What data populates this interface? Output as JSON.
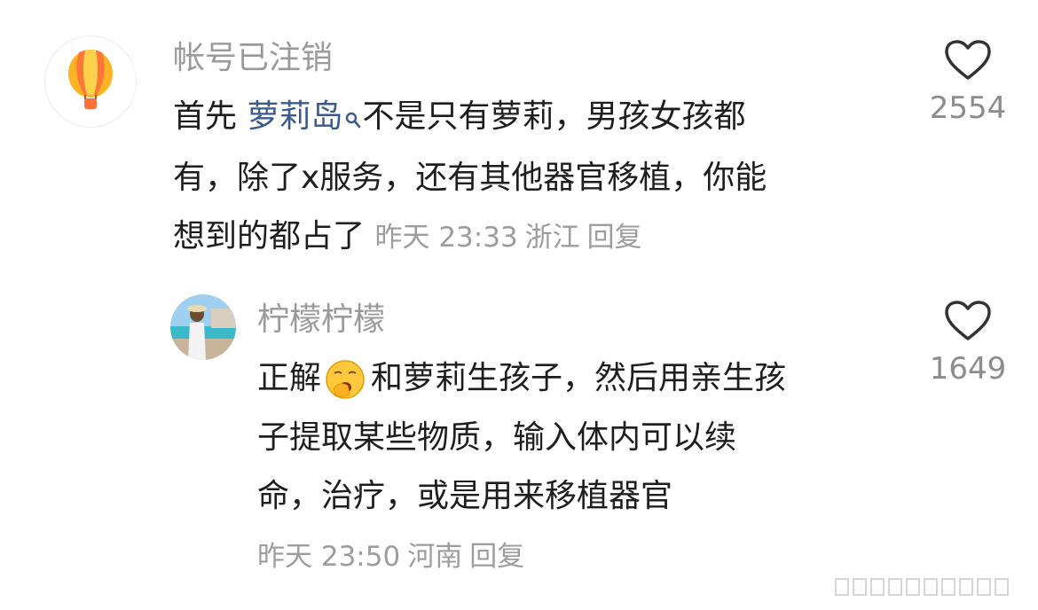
{
  "colors": {
    "username": "#9a9a9a",
    "body_text": "#1e1e1e",
    "link": "#3a5a8e",
    "meta": "#9d9d9d",
    "like_count": "#8c8c8c"
  },
  "main_comment": {
    "username": "帐号已注销",
    "avatar_icon": "hot-air-balloon-icon",
    "text_line1_prefix": "首先 ",
    "link_text": "萝莉岛",
    "link_icon": "search-icon",
    "text_line1_suffix": "不是只有萝莉，男孩女孩都",
    "text_line2": "有，除了x服务，还有其他器官移植，你能",
    "text_line3": "想到的都占了",
    "time": "昨天 23:33",
    "location": "浙江",
    "reply_label": "回复",
    "like_icon": "heart-outline-icon",
    "like_count": "2554"
  },
  "reply_comment": {
    "username": "柠檬柠檬",
    "avatar_icon": "beach-photo-avatar",
    "text_line1_prefix": "正解",
    "emoji": "yawning-face-emoji",
    "text_line1_suffix": "和萝莉生孩子，然后用亲生孩",
    "text_line2": "子提取某些物质，输入体内可以续",
    "text_line3": "命，治疗，或是用来移植器官",
    "time": "昨天 23:50",
    "location": "河南",
    "reply_label": "回复",
    "like_icon": "heart-outline-icon",
    "like_count": "1649"
  }
}
